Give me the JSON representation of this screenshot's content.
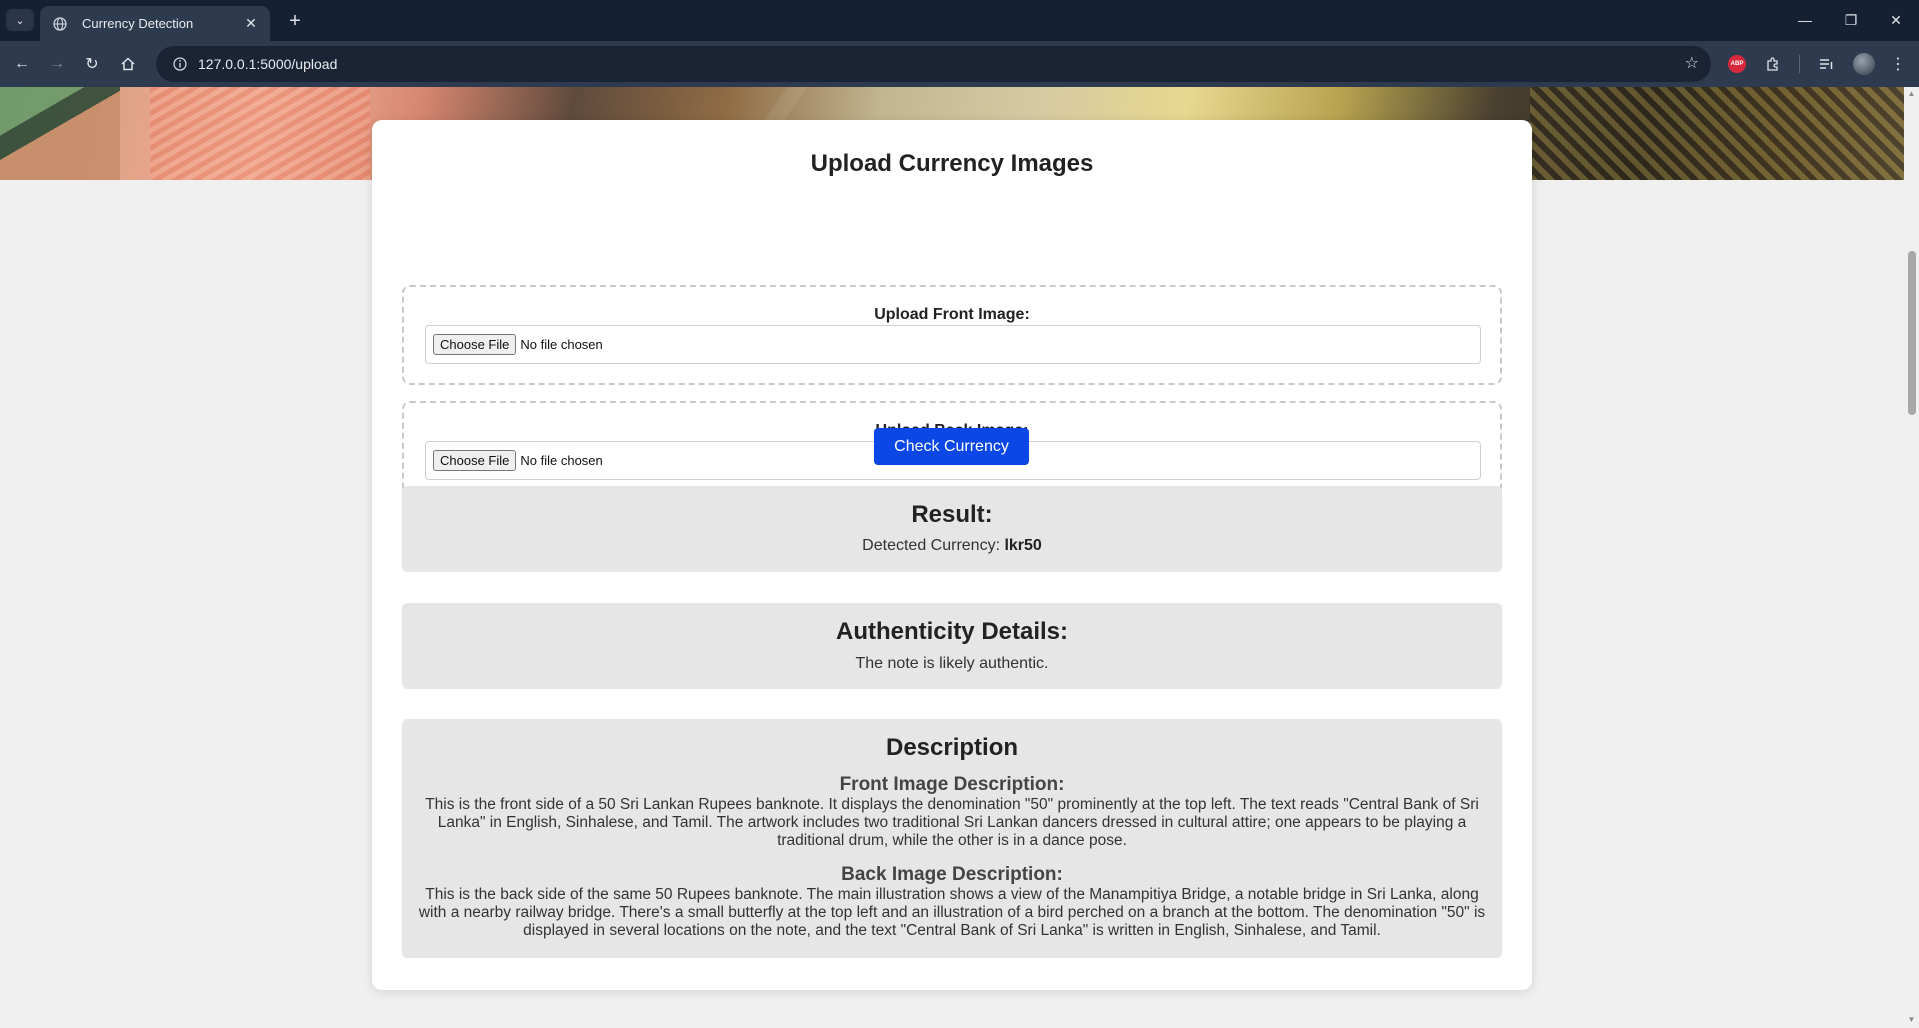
{
  "browser": {
    "tab_title": "Currency Detection",
    "url": "127.0.0.1:5000/upload",
    "abp_label": "ABP",
    "icons": [
      "tab-search-icon",
      "globe-icon",
      "close-icon",
      "plus-icon",
      "back-arrow-icon",
      "forward-arrow-icon",
      "reload-icon",
      "home-icon",
      "site-info-icon",
      "star-icon",
      "extensions-icon",
      "reading-list-icon",
      "menu-icon"
    ]
  },
  "page": {
    "title": "Upload Currency Images",
    "front_upload": {
      "label": "Upload Front Image:",
      "button": "Choose File",
      "status": "No file chosen"
    },
    "back_upload": {
      "label": "Upload Back Image:",
      "button": "Choose File",
      "status": "No file chosen"
    },
    "check_button": "Check Currency",
    "result": {
      "heading": "Result:",
      "label": "Detected Currency: ",
      "value": "lkr50"
    },
    "authenticity": {
      "heading": "Authenticity Details:",
      "text": "The note is likely authentic."
    },
    "description": {
      "heading": "Description",
      "front_heading": "Front Image Description:",
      "front_text": "This is the front side of a 50 Sri Lankan Rupees banknote. It displays the denomination \"50\" prominently at the top left. The text reads \"Central Bank of Sri Lanka\" in English, Sinhalese, and Tamil. The artwork includes two traditional Sri Lankan dancers dressed in cultural attire; one appears to be playing a traditional drum, while the other is in a dance pose.",
      "back_heading": "Back Image Description:",
      "back_text": "This is the back side of the same 50 Rupees banknote. The main illustration shows a view of the Manampitiya Bridge, a notable bridge in Sri Lanka, along with a nearby railway bridge. There's a small butterfly at the top left and an illustration of a bird perched on a branch at the bottom. The denomination \"50\" is displayed in several locations on the note, and the text \"Central Bank of Sri Lanka\" is written in English, Sinhalese, and Tamil."
    }
  },
  "colors": {
    "chrome_dark": "#162033",
    "chrome_toolbar": "#2e3a4d",
    "primary_button": "#0b47e6",
    "panel_bg": "#e6e6e6"
  }
}
